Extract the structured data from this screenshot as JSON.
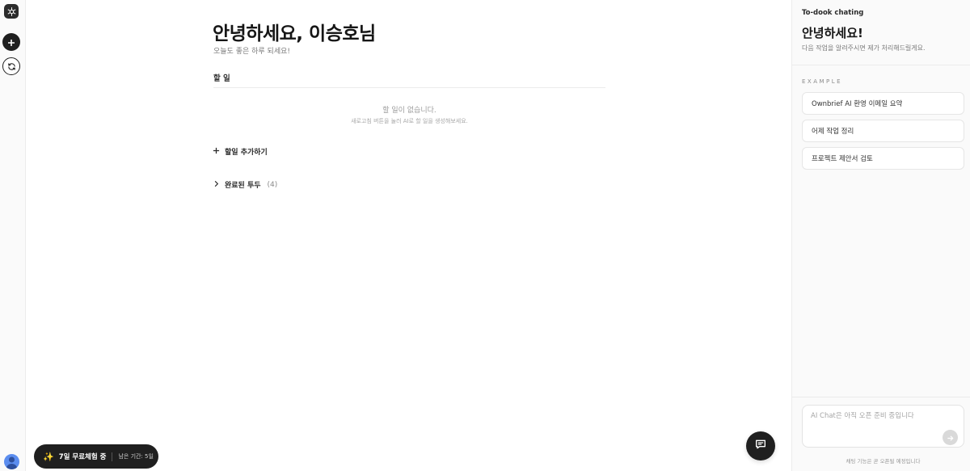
{
  "sidebar": {
    "logo_icon": "openai-logo-icon",
    "add_icon": "plus-icon",
    "refresh_icon": "refresh-icon",
    "avatar_icon": "user-avatar-icon"
  },
  "main": {
    "title": "안녕하세요, 이승호님",
    "subtitle": "오늘도 좋은 하루 되세요!",
    "section_label": "할 일",
    "empty_title": "할 일이 없습니다.",
    "empty_sub": "새로고침 버튼을 눌러 AI로 할 일을 생성해보세요.",
    "add_todo": "할일 추가하기",
    "completed_label": "완료된 투두",
    "completed_count": "(4)"
  },
  "trial": {
    "icon": "sparkles-icon",
    "label": "7일 무료체험 중",
    "remaining": "남은 기간: 5일"
  },
  "chat_fab_icon": "chat-bubble-icon",
  "panel": {
    "app_name": "To-dook chating",
    "greeting": "안녕하세요!",
    "subtitle": "다음 작업을 알려주시면 제가 처리해드릴게요.",
    "example_label": "EXAMPLE",
    "examples": [
      "Ownbrief AI 환영 이메일 요약",
      "어제 작업 정리",
      "프로젝트 제안서 검토"
    ],
    "input_placeholder": "AI Chat은 아직 오픈 준비 중입니다",
    "note": "채팅 기능은 곧 오픈될 예정입니다"
  },
  "colors": {
    "dark": "#1f1f1f",
    "accent_gold": "#f0c14b",
    "avatar_blue": "#5b8def"
  }
}
